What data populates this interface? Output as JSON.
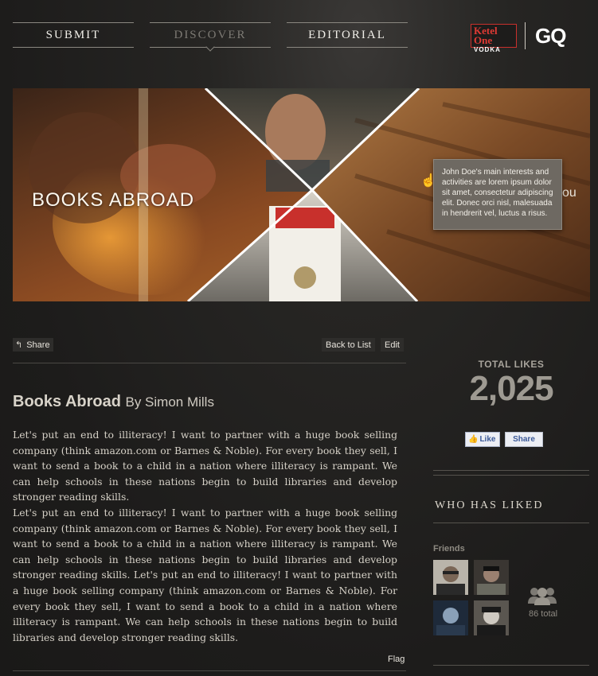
{
  "nav": {
    "items": [
      {
        "label": "SUBMIT"
      },
      {
        "label": "DISCOVER"
      },
      {
        "label": "EDITORIAL"
      }
    ]
  },
  "brand": {
    "ketel_line1": "Ketel One",
    "ketel_line2": "VODKA",
    "gq": "GQ"
  },
  "hero": {
    "title": "BOOKS ABROAD",
    "tooltip": "John Doe's main interests and activities are lorem ipsum dolor sit amet, consectetur adipiscing elit. Donec orci nisl, malesuada in hendrerit vel, luctus a risus.",
    "fragment": "ou"
  },
  "toolbar": {
    "share_label": "Share",
    "back_label": "Back to List",
    "edit_label": "Edit"
  },
  "post": {
    "title": "Books Abroad",
    "author": "By Simon Mills",
    "paragraph1": "Let's put an end to illiteracy! I want to partner with a huge book selling company (think amazon.com or Barnes & Noble). For every book they sell, I want to send a book to a child in a nation where illiteracy is rampant. We can help schools in these nations begin to build libraries and develop stronger reading skills.",
    "paragraph2": "Let's put an end to illiteracy! I want to partner with a huge book selling company (think amazon.com or Barnes & Noble). For every book they sell, I want to send a book to a child in a nation where illiteracy is rampant. We can help schools in these nations begin to build libraries and develop stronger reading skills. Let's put an end to illiteracy! I want to partner with a huge book selling company (think amazon.com or Barnes & Noble). For every book they sell, I want to send a book to a child in a nation where illiteracy is rampant. We can help schools in these nations begin to build libraries and develop stronger reading skills.",
    "flag_label": "Flag"
  },
  "likes": {
    "label": "TOTAL LIKES",
    "count": "2,025",
    "fb_like_label": "Like",
    "fb_share_label": "Share"
  },
  "who_liked": {
    "heading": "WHO HAS LIKED",
    "friends_label": "Friends",
    "total_label": "86 total"
  },
  "icons": {
    "share": "share-icon",
    "thumb": "thumbs-up-icon",
    "group": "group-icon",
    "cursor": "hand-cursor-icon"
  },
  "colors": {
    "background": "#1d1c1b",
    "text": "#e8e4dc",
    "muted": "#8d8981",
    "ketel_red": "#c8302c",
    "facebook_blue": "#3b5998"
  }
}
